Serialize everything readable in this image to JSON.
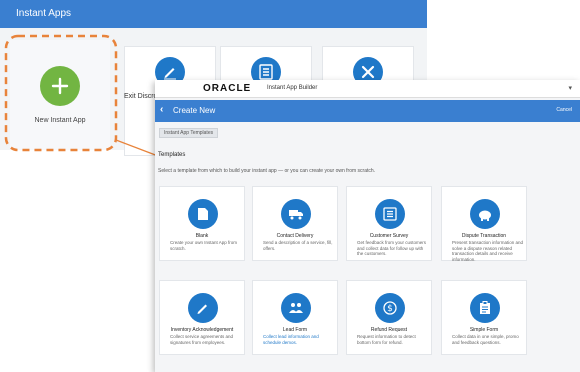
{
  "colors": {
    "header_blue": "#3a7fd0",
    "icon_blue": "#1f78c8",
    "new_app_green": "#72b542",
    "highlight_orange": "#e8833a"
  },
  "background_window": {
    "title": "Instant Apps",
    "cards": [
      {
        "icon": "pen-icon",
        "label": "Exit Discro"
      },
      {
        "icon": "checklist-icon",
        "label": ""
      },
      {
        "icon": "tools-icon",
        "label": ""
      }
    ],
    "new_app": {
      "icon": "plus-icon",
      "label": "New Instant App"
    }
  },
  "builder": {
    "brand": "ORACLE",
    "product_name": "Instant App Builder",
    "user_menu_icon": "user-menu-icon",
    "page_title": "Create New",
    "cancel_label": "Cancel",
    "breadcrumb": "Instant App Templates",
    "templates_heading": "Templates",
    "templates_description": "Select a template from which to build your instant app — or you can create your own from scratch.",
    "templates": [
      {
        "icon": "document-icon",
        "title": "Blank",
        "description": "Create your own Instant App from scratch."
      },
      {
        "icon": "truck-icon",
        "title": "Contact Delivery",
        "description": "Send a description of a service, fill, offers."
      },
      {
        "icon": "list-icon",
        "title": "Customer Survey",
        "description": "Get feedback from your customers and collect data for follow up with the customers."
      },
      {
        "icon": "piggy-bank-icon",
        "title": "Dispute Transaction",
        "description": "Present transaction information and solve a dispute reason related transaction details and receive information."
      },
      {
        "icon": "pen-icon",
        "title": "Inventory Acknowledgement",
        "description": "Collect service agreements and signatures from employees."
      },
      {
        "icon": "people-icon",
        "title": "Lead Form",
        "description": "Collect lead information and schedule demos."
      },
      {
        "icon": "dollar-icon",
        "title": "Refund Request",
        "description": "Request information to detect bottom form for refund."
      },
      {
        "icon": "clipboard-icon",
        "title": "Simple Form",
        "description": "Collect data in one simple, promo and feedback questions."
      }
    ]
  }
}
